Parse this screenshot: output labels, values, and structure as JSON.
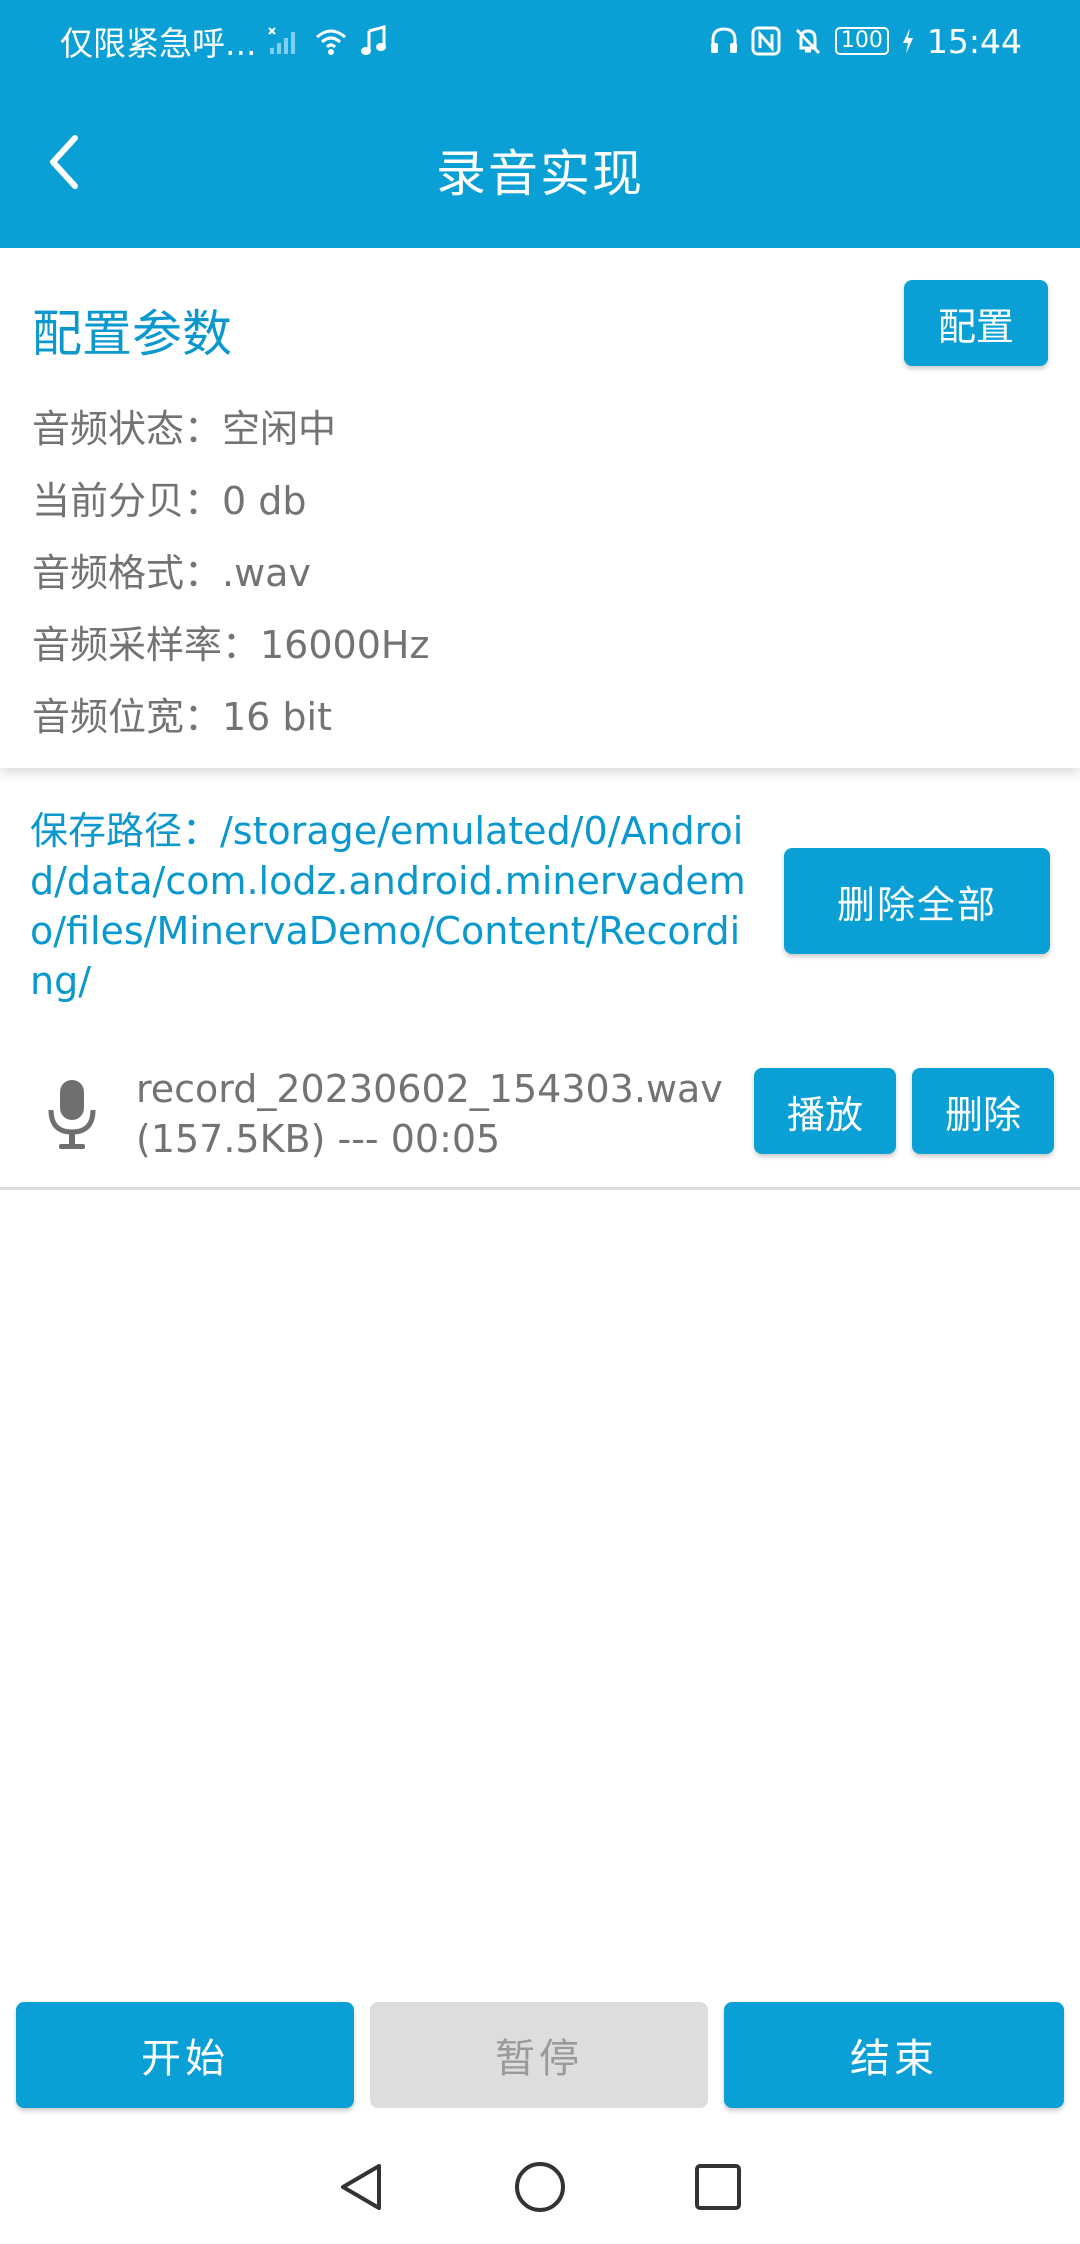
{
  "colors": {
    "primary": "#0aa0d6",
    "accent_text": "#0a98cf",
    "secondary_text": "#737373",
    "disabled": "#dddddd"
  },
  "status_bar": {
    "carrier": "仅限紧急呼...",
    "time": "15:44",
    "battery": "100"
  },
  "toolbar": {
    "title": "录音实现",
    "back_icon": "chevron-left-icon"
  },
  "config": {
    "title": "配置参数",
    "button_label": "配置",
    "params": [
      "音频状态：空闲中",
      "当前分贝：0 db",
      "音频格式：.wav",
      "音频采样率：16000Hz",
      "音频位宽：16 bit"
    ]
  },
  "storage": {
    "path": "保存路径：/storage/emulated/0/Android/data/com.lodz.android.minervademo/files/MinervaDemo/Content/Recording/",
    "delete_all_label": "删除全部"
  },
  "recordings": [
    {
      "name": "record_20230602_154303.wav",
      "info": "(157.5KB) --- 00:05",
      "play_label": "播放",
      "delete_label": "删除",
      "icon": "microphone-icon"
    }
  ],
  "controls": {
    "start": "开始",
    "pause": "暂停",
    "stop": "结束",
    "pause_enabled": false
  },
  "navigation": {
    "back_icon": "nav-back-icon",
    "home_icon": "nav-home-icon",
    "recents_icon": "nav-recents-icon"
  }
}
